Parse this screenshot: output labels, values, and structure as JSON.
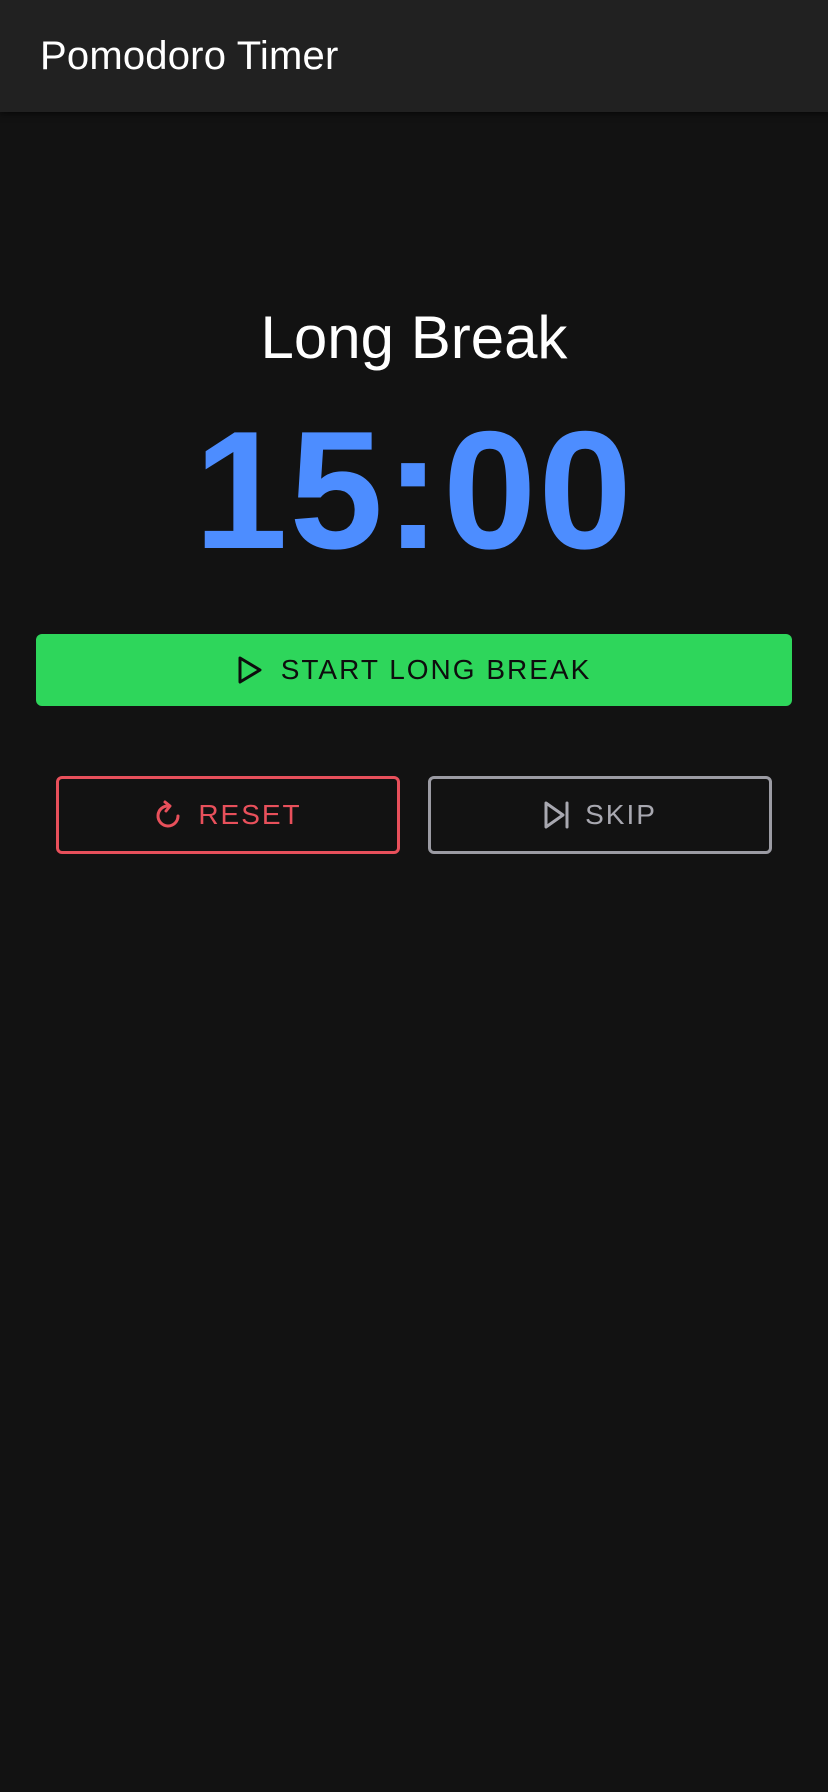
{
  "app_bar": {
    "title": "Pomodoro Timer"
  },
  "timer": {
    "mode": "Long Break",
    "time": "15:00",
    "color": "#4d8dff"
  },
  "actions": {
    "start_label": "START LONG BREAK",
    "start_icon": "play-icon",
    "start_color": "#2ed65b",
    "reset_label": "RESET",
    "reset_icon": "refresh-icon",
    "reset_color": "#e8505b",
    "skip_label": "SKIP",
    "skip_icon": "skip-next-icon",
    "skip_color": "#9b9ba3"
  },
  "theme": {
    "background": "#121212",
    "app_bar_background": "#212121"
  }
}
